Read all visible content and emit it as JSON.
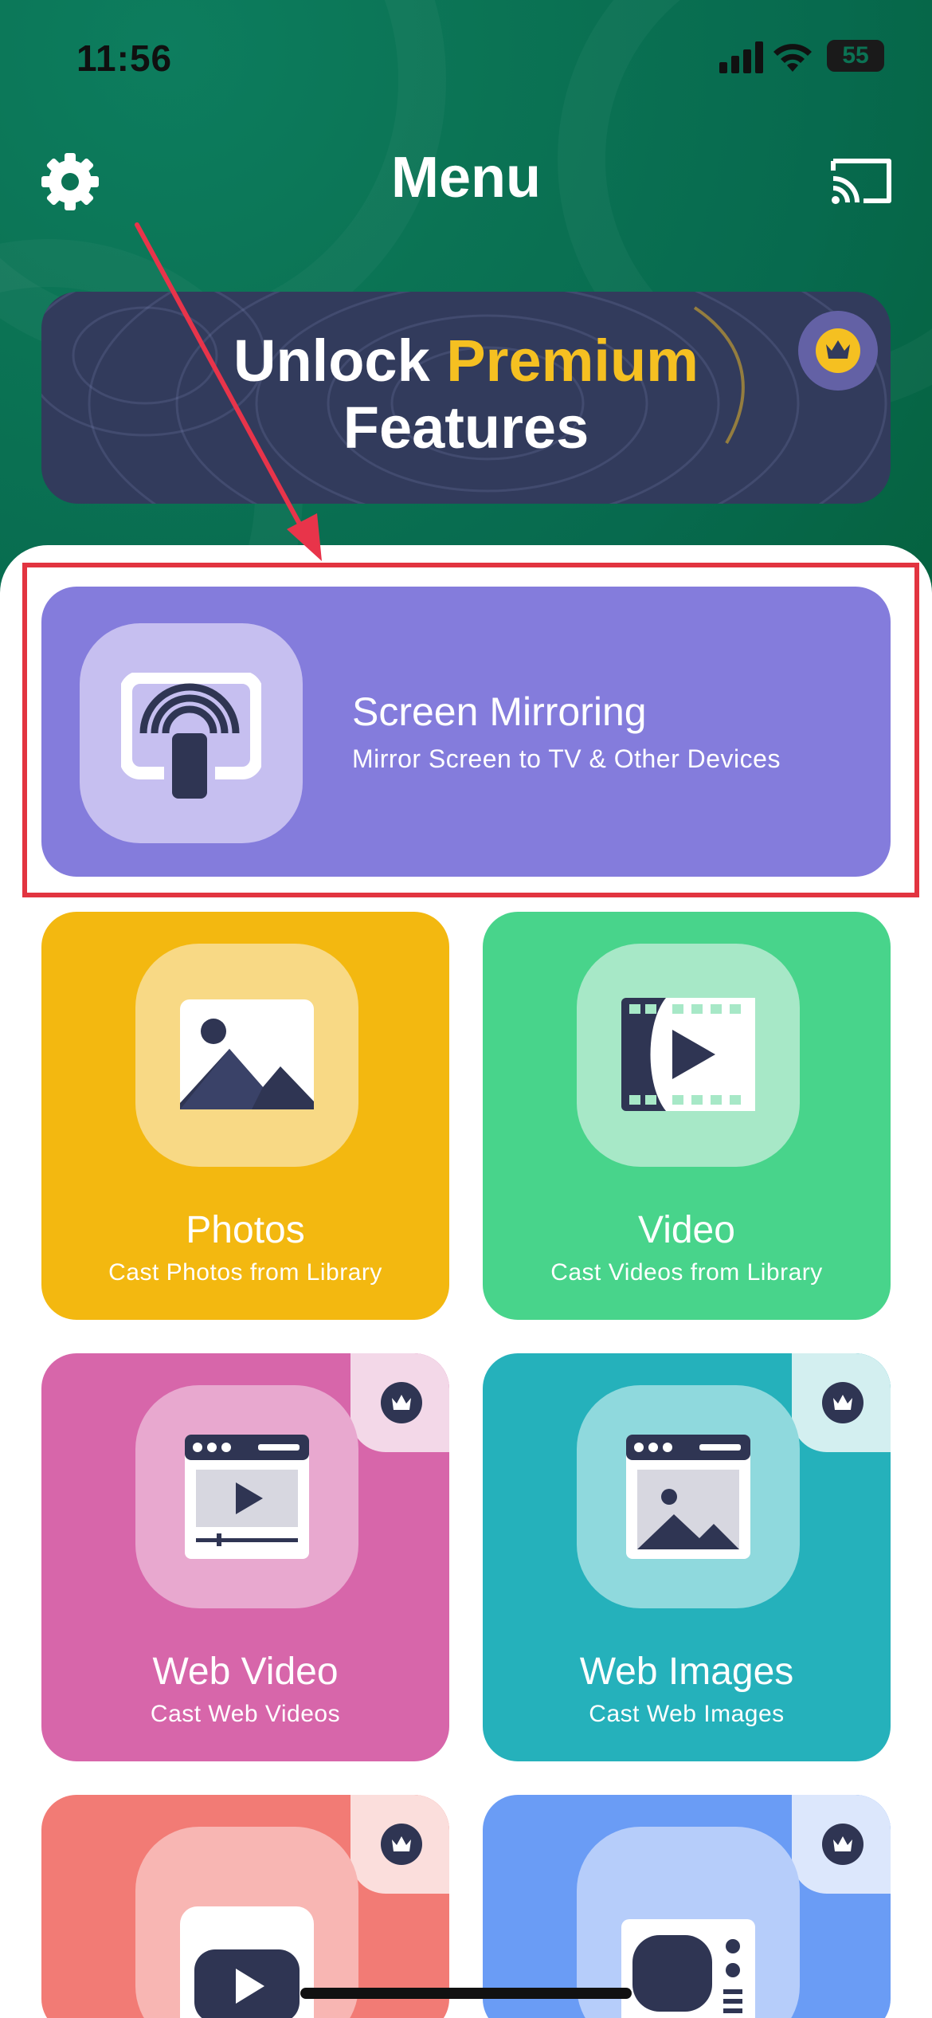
{
  "status_bar": {
    "time": "11:56",
    "battery": "55"
  },
  "nav": {
    "title": "Menu",
    "settings_icon": "gear-icon",
    "cast_icon": "cast-icon"
  },
  "premium": {
    "line1_prefix": "Unlock",
    "line1_accent": "Premium",
    "line2": "Features",
    "badge_icon": "crown-icon",
    "accent_color": "#f5c021"
  },
  "mirror": {
    "title": "Screen Mirroring",
    "subtitle": "Mirror Screen to TV & Other Devices",
    "icon": "screen-mirroring-icon",
    "color": "#847cdc"
  },
  "tiles": [
    {
      "title": "Photos",
      "subtitle": "Cast Photos from Library",
      "icon": "photo-icon",
      "color": "#f3b810",
      "premium": false
    },
    {
      "title": "Video",
      "subtitle": "Cast Videos from Library",
      "icon": "film-play-icon",
      "color": "#48d48b",
      "premium": false
    },
    {
      "title": "Web Video",
      "subtitle": "Cast Web Videos",
      "icon": "web-video-icon",
      "color": "#d766aa",
      "premium": true
    },
    {
      "title": "Web Images",
      "subtitle": "Cast Web Images",
      "icon": "web-image-icon",
      "color": "#25b1bb",
      "premium": true
    },
    {
      "title": "",
      "subtitle": "",
      "icon": "youtube-icon",
      "color": "#f27b75",
      "premium": true
    },
    {
      "title": "",
      "subtitle": "",
      "icon": "tv-icon",
      "color": "#6a9cf5",
      "premium": true
    }
  ]
}
